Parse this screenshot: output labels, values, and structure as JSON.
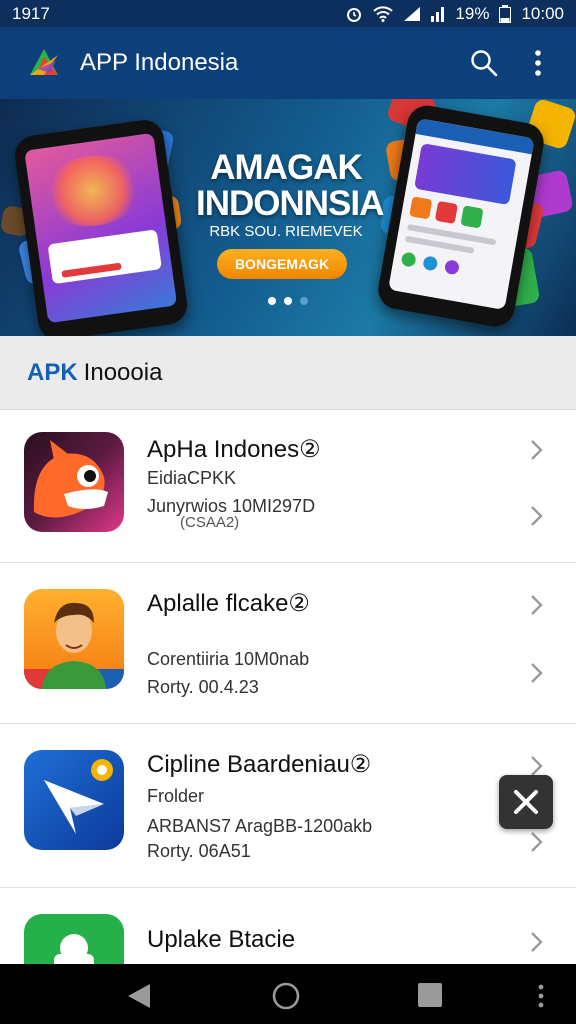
{
  "status": {
    "time": "1917",
    "battery": "19%",
    "clock": "10:00"
  },
  "appbar": {
    "title": "APP Indonesia"
  },
  "banner": {
    "headline_line1": "AMAGAK",
    "headline_line2": "INDONNSIA",
    "subline": "RBK SOU. RIEMEVEK",
    "button_label": "BONGEMAGK"
  },
  "section": {
    "prefix": "APK",
    "title": "Inoooia"
  },
  "apps": [
    {
      "name": "ApHa Indones②",
      "line1": "EidiaCPKK",
      "line2": "Junyrwios   10MI297D",
      "line3": "(CSAA2)"
    },
    {
      "name": "Aplalle flcake②",
      "line1": "Corentiiria  10M0nab",
      "line2": "Rorty. 00.4.23",
      "line3": ""
    },
    {
      "name": "Cipline Baardeniau②",
      "line1": "Frolder",
      "line2": "ARBANS7 AragBB-1200akb",
      "line3": "Rorty. 06A51"
    },
    {
      "name": "Uplake Btacie",
      "line1": "",
      "line2": "",
      "line3": ""
    }
  ],
  "icons": [
    "logo-icon",
    "search-icon",
    "more-vert-icon",
    "chevron-right-icon",
    "close-icon",
    "back-icon",
    "home-icon",
    "recents-icon"
  ]
}
